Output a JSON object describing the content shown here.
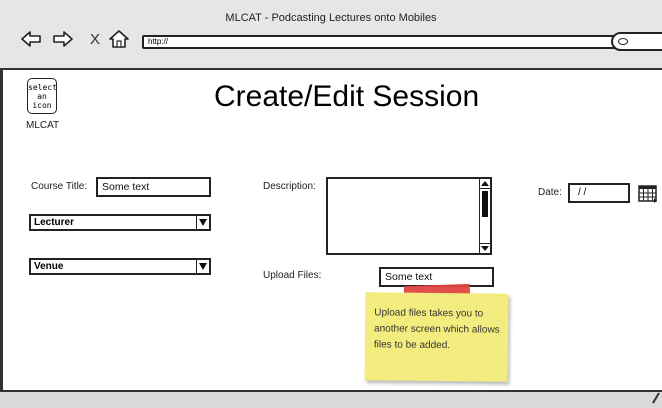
{
  "browser": {
    "window_title": "MLCAT - Podcasting Lectures onto Mobiles",
    "url": "http://",
    "nav_icons": [
      "back-arrow-icon",
      "forward-arrow-icon",
      "stop-x-icon",
      "home-icon"
    ],
    "close_glyph": "X"
  },
  "logo": {
    "placeholder": "select an icon",
    "caption": "MLCAT"
  },
  "page": {
    "title": "Create/Edit Session"
  },
  "form": {
    "course_title_label": "Course Title:",
    "course_title_value": "Some text",
    "lecturer_selected": "Lecturer",
    "venue_selected": "Venue",
    "description_label": "Description:",
    "description_value": "",
    "upload_label": "Upload Files:",
    "upload_value": "Some text",
    "date_label": "Date:",
    "date_value": "/ /"
  },
  "note": {
    "text": "Upload files takes you to another screen which allows files to be added.",
    "color": "#f3ec7e",
    "tape_color": "#e04542"
  }
}
